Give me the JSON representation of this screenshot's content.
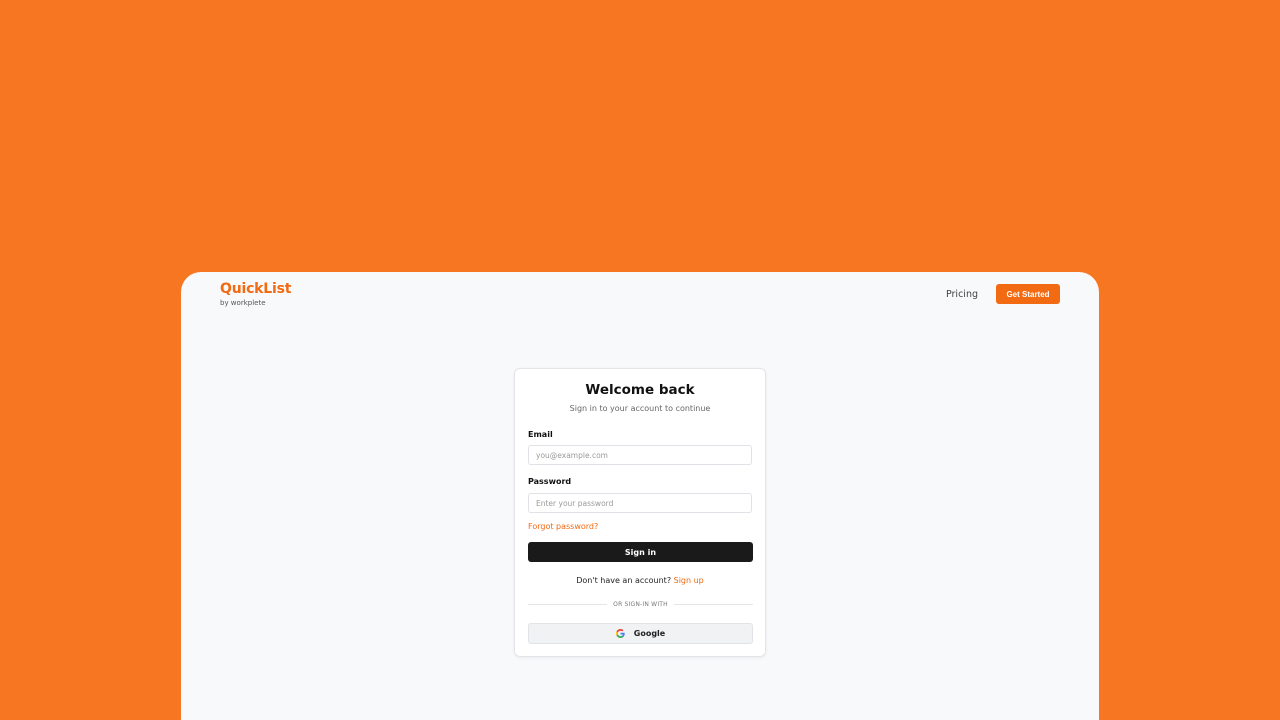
{
  "brand": {
    "name": "QuickList",
    "subtitle": "by workplete"
  },
  "nav": {
    "pricing": "Pricing",
    "cta": "Get Started"
  },
  "card": {
    "title": "Welcome back",
    "subtitle": "Sign in to your account to continue",
    "email_label": "Email",
    "email_placeholder": "you@example.com",
    "email_value": "",
    "password_label": "Password",
    "password_placeholder": "Enter your password",
    "password_value": "",
    "forgot": "Forgot password?",
    "signin": "Sign in",
    "no_account": "Don't have an account?",
    "signup": "Sign up",
    "divider": "OR SIGN-IN WITH",
    "google": "Google"
  },
  "icons": {
    "google": "google-g-icon"
  },
  "colors": {
    "background": "#f77622",
    "accent": "#f26a12",
    "primary_button": "#1a1a1a"
  }
}
